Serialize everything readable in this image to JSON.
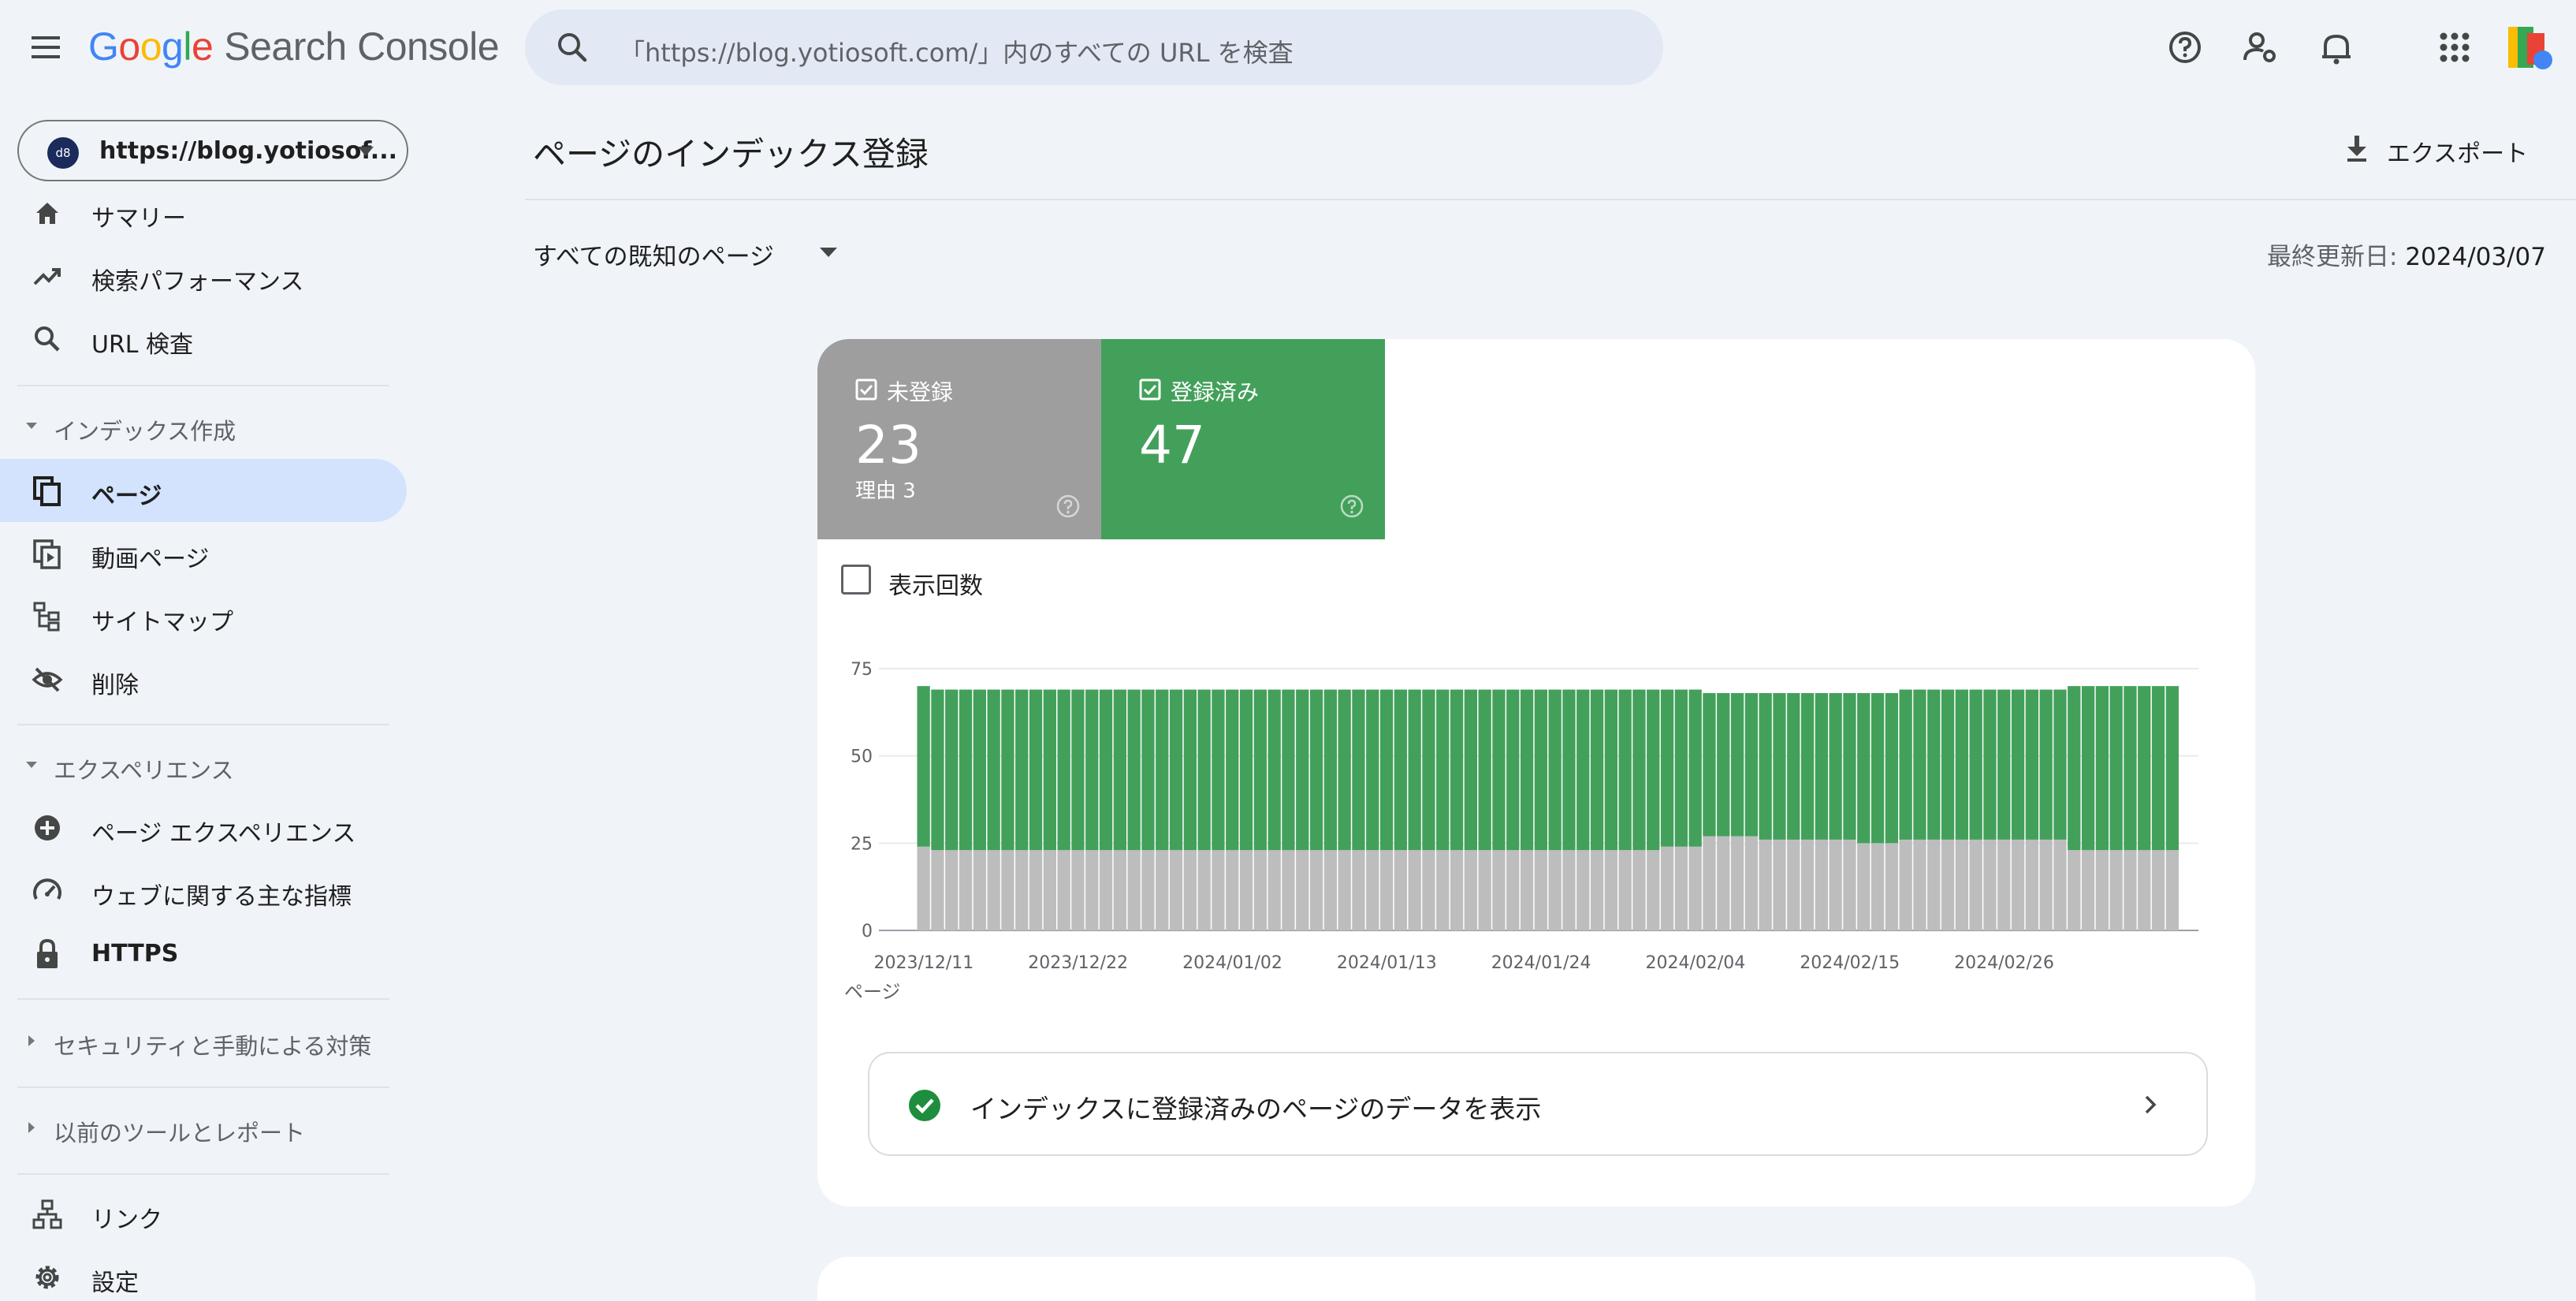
{
  "header": {
    "menu_icon": "menu-icon",
    "logo": {
      "g1": "G",
      "g2": "o",
      "g3": "o",
      "g4": "g",
      "g5": "l",
      "g6": "e",
      "product": "Search Console"
    },
    "search_placeholder": "「https://blog.yotiosoft.com/」内のすべての URL を検査",
    "icons": [
      "help-icon",
      "manage-accounts-icon",
      "notifications-icon",
      "apps-icon",
      "account-avatar"
    ]
  },
  "sidebar": {
    "property": {
      "avatar_text": "d8",
      "label": "https://blog.yotiosof..."
    },
    "top_items": [
      {
        "label": "サマリー",
        "icon": "home-icon"
      },
      {
        "label": "検索パフォーマンス",
        "icon": "trending-up-icon"
      },
      {
        "label": "URL 検査",
        "icon": "search-icon"
      }
    ],
    "index_section": "インデックス作成",
    "index_items": [
      {
        "label": "ページ",
        "icon": "pages-icon",
        "active": true
      },
      {
        "label": "動画ページ",
        "icon": "video-pages-icon"
      },
      {
        "label": "サイトマップ",
        "icon": "sitemap-icon"
      },
      {
        "label": "削除",
        "icon": "visibility-off-icon"
      }
    ],
    "experience_section": "エクスペリエンス",
    "experience_items": [
      {
        "label": "ページ エクスペリエンス",
        "icon": "add-circle-icon"
      },
      {
        "label": "ウェブに関する主な指標",
        "icon": "speed-icon"
      },
      {
        "label": "HTTPS",
        "icon": "lock-icon"
      }
    ],
    "security_section": "セキュリティと手動による対策",
    "legacy_section": "以前のツールとレポート",
    "bottom_items": [
      {
        "label": "リンク",
        "icon": "links-icon"
      },
      {
        "label": "設定",
        "icon": "settings-icon"
      }
    ]
  },
  "main": {
    "title": "ページのインデックス登録",
    "export_label": "エクスポート",
    "filter_label": "すべての既知のページ",
    "last_updated_label": "最終更新日:",
    "last_updated_value": "2024/03/07",
    "tiles": {
      "not_indexed": {
        "label": "未登録",
        "count": "23",
        "sub": "理由 3",
        "color": "#9e9e9e"
      },
      "indexed": {
        "label": "登録済み",
        "count": "47",
        "color": "#43a05b"
      }
    },
    "impressions_label": "表示回数",
    "view_data_label": "インデックスに登録済みのページのデータを表示"
  },
  "chart_data": {
    "type": "bar",
    "stacked": true,
    "ylabel": "ページ",
    "ylim": [
      0,
      75
    ],
    "yticks": [
      0,
      25,
      50,
      75
    ],
    "xtick_labels": [
      "2023/12/11",
      "2023/12/22",
      "2024/01/02",
      "2024/01/13",
      "2024/01/24",
      "2024/02/04",
      "2024/02/15",
      "2024/02/26"
    ],
    "start_date": "2023/12/11",
    "series": [
      {
        "name": "未登録",
        "color": "#bdbdbd",
        "values": [
          24,
          23,
          23,
          23,
          23,
          23,
          23,
          23,
          23,
          23,
          23,
          23,
          23,
          23,
          23,
          23,
          23,
          23,
          23,
          23,
          23,
          23,
          23,
          23,
          23,
          23,
          23,
          23,
          23,
          23,
          23,
          23,
          23,
          23,
          23,
          23,
          23,
          23,
          23,
          23,
          23,
          23,
          23,
          23,
          23,
          23,
          23,
          23,
          23,
          23,
          23,
          23,
          23,
          24,
          24,
          24,
          27,
          27,
          27,
          27,
          26,
          26,
          26,
          26,
          26,
          26,
          26,
          25,
          25,
          25,
          26,
          26,
          26,
          26,
          26,
          26,
          26,
          26,
          26,
          26,
          26,
          26,
          23,
          23,
          23,
          23,
          23,
          23,
          23,
          23
        ]
      },
      {
        "name": "登録済み",
        "color": "#43a05b",
        "values": [
          46,
          46,
          46,
          46,
          46,
          46,
          46,
          46,
          46,
          46,
          46,
          46,
          46,
          46,
          46,
          46,
          46,
          46,
          46,
          46,
          46,
          46,
          46,
          46,
          46,
          46,
          46,
          46,
          46,
          46,
          46,
          46,
          46,
          46,
          46,
          46,
          46,
          46,
          46,
          46,
          46,
          46,
          46,
          46,
          46,
          46,
          46,
          46,
          46,
          46,
          46,
          46,
          46,
          45,
          45,
          45,
          41,
          41,
          41,
          41,
          42,
          42,
          42,
          42,
          42,
          42,
          42,
          43,
          43,
          43,
          43,
          43,
          43,
          43,
          43,
          43,
          43,
          43,
          43,
          43,
          43,
          43,
          47,
          47,
          47,
          47,
          47,
          47,
          47,
          47
        ]
      }
    ]
  }
}
